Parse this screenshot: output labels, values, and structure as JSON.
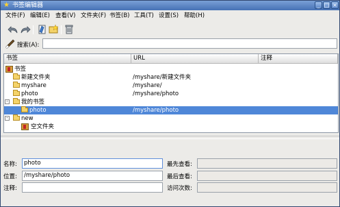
{
  "window": {
    "title": "书签编辑器"
  },
  "menubar": [
    "文件(F)",
    "编辑(E)",
    "查看(V)",
    "文件夹(F)",
    "书签(B)",
    "工具(T)",
    "设置(S)",
    "帮助(H)"
  ],
  "search": {
    "label": "搜索(A):",
    "value": ""
  },
  "tree": {
    "columns": [
      "书签",
      "URL",
      "注释"
    ],
    "rows": [
      {
        "name": "书签",
        "url": "",
        "level": 0,
        "icon": "bookmark-folder",
        "expander": "",
        "selected": false
      },
      {
        "name": "新建文件夹",
        "url": "/myshare/新建文件夹",
        "level": 1,
        "icon": "folder",
        "expander": "",
        "selected": false
      },
      {
        "name": "myshare",
        "url": "/myshare/",
        "level": 1,
        "icon": "folder",
        "expander": "",
        "selected": false
      },
      {
        "name": "photo",
        "url": "/myshare/photo",
        "level": 1,
        "icon": "folder",
        "expander": "",
        "selected": false
      },
      {
        "name": "我的书签",
        "url": "",
        "level": 1,
        "icon": "folder",
        "expander": "-",
        "selected": false
      },
      {
        "name": "photo",
        "url": "/myshare/photo",
        "level": 2,
        "icon": "folder",
        "expander": "",
        "selected": true
      },
      {
        "name": "new",
        "url": "",
        "level": 1,
        "icon": "folder",
        "expander": "-",
        "selected": false
      },
      {
        "name": "空文件夹",
        "url": "",
        "level": 2,
        "icon": "bookmark-folder",
        "expander": "",
        "selected": false
      }
    ]
  },
  "details": {
    "name_label": "名称:",
    "name_value": "photo",
    "location_label": "位置:",
    "location_value": "/myshare/photo",
    "comment_label": "注释:",
    "comment_value": "",
    "first_seen_label": "最先查看:",
    "first_seen_value": "",
    "last_seen_label": "最后查看:",
    "last_seen_value": "",
    "visit_count_label": "访问次数:",
    "visit_count_value": ""
  },
  "colors": {
    "title_bar": "#4671b5",
    "selection": "#4f87d8",
    "window_background": "#ecebe8"
  }
}
